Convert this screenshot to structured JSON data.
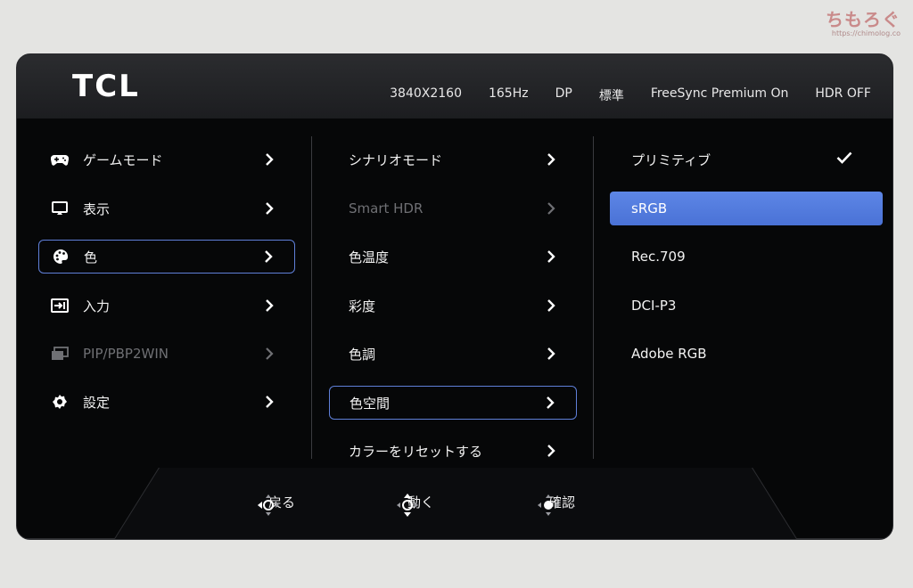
{
  "watermark": {
    "main": "ちもろぐ",
    "sub": "https://chimolog.co"
  },
  "header": {
    "logo": "TCL",
    "status": [
      "3840X2160",
      "165Hz",
      "DP",
      "標準",
      "FreeSync Premium On",
      "HDR OFF"
    ]
  },
  "menu": {
    "main": [
      {
        "label": "ゲームモード",
        "icon": "gamepad-icon"
      },
      {
        "label": "表示",
        "icon": "display-icon"
      },
      {
        "label": "色",
        "icon": "palette-icon",
        "selected": true
      },
      {
        "label": "入力",
        "icon": "input-icon"
      },
      {
        "label": "PIP/PBP2WIN",
        "icon": "pip-icon",
        "disabled": true
      },
      {
        "label": "設定",
        "icon": "gear-icon"
      }
    ],
    "sub": [
      {
        "label": "シナリオモード"
      },
      {
        "label": "Smart HDR",
        "disabled": true
      },
      {
        "label": "色温度"
      },
      {
        "label": "彩度"
      },
      {
        "label": "色調"
      },
      {
        "label": "色空間",
        "selected": true
      },
      {
        "label": "カラーをリセットする"
      }
    ],
    "options": [
      {
        "label": "プリミティブ",
        "checked": true
      },
      {
        "label": "sRGB",
        "highlighted": true
      },
      {
        "label": "Rec.709"
      },
      {
        "label": "DCI-P3"
      },
      {
        "label": "Adobe RGB"
      }
    ]
  },
  "footer": {
    "back": "戻る",
    "move": "動く",
    "confirm": "確認"
  },
  "colors": {
    "accent": "#5d86e6",
    "selected_border": "#5f7fd8",
    "background": "#060708"
  }
}
